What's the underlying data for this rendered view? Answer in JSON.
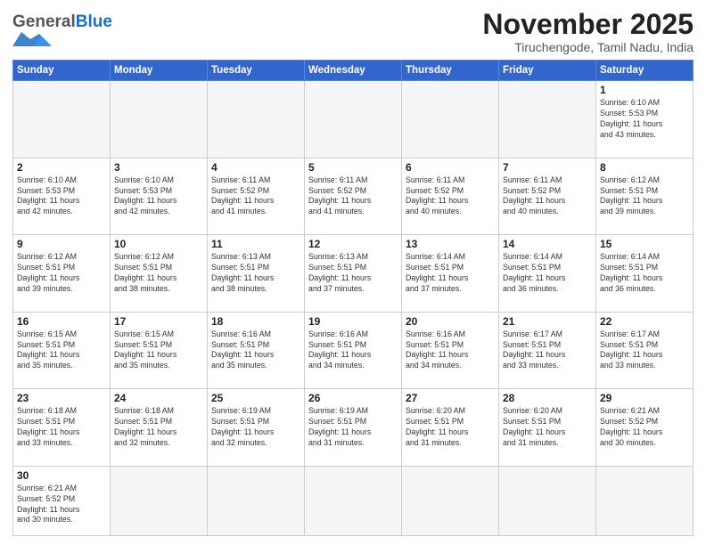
{
  "header": {
    "logo_general": "General",
    "logo_blue": "Blue",
    "month_title": "November 2025",
    "location": "Tiruchengode, Tamil Nadu, India"
  },
  "days_of_week": [
    "Sunday",
    "Monday",
    "Tuesday",
    "Wednesday",
    "Thursday",
    "Friday",
    "Saturday"
  ],
  "weeks": [
    [
      {
        "day": "",
        "info": ""
      },
      {
        "day": "",
        "info": ""
      },
      {
        "day": "",
        "info": ""
      },
      {
        "day": "",
        "info": ""
      },
      {
        "day": "",
        "info": ""
      },
      {
        "day": "",
        "info": ""
      },
      {
        "day": "1",
        "info": "Sunrise: 6:10 AM\nSunset: 5:53 PM\nDaylight: 11 hours\nand 43 minutes."
      }
    ],
    [
      {
        "day": "2",
        "info": "Sunrise: 6:10 AM\nSunset: 5:53 PM\nDaylight: 11 hours\nand 42 minutes."
      },
      {
        "day": "3",
        "info": "Sunrise: 6:10 AM\nSunset: 5:53 PM\nDaylight: 11 hours\nand 42 minutes."
      },
      {
        "day": "4",
        "info": "Sunrise: 6:11 AM\nSunset: 5:52 PM\nDaylight: 11 hours\nand 41 minutes."
      },
      {
        "day": "5",
        "info": "Sunrise: 6:11 AM\nSunset: 5:52 PM\nDaylight: 11 hours\nand 41 minutes."
      },
      {
        "day": "6",
        "info": "Sunrise: 6:11 AM\nSunset: 5:52 PM\nDaylight: 11 hours\nand 40 minutes."
      },
      {
        "day": "7",
        "info": "Sunrise: 6:11 AM\nSunset: 5:52 PM\nDaylight: 11 hours\nand 40 minutes."
      },
      {
        "day": "8",
        "info": "Sunrise: 6:12 AM\nSunset: 5:51 PM\nDaylight: 11 hours\nand 39 minutes."
      }
    ],
    [
      {
        "day": "9",
        "info": "Sunrise: 6:12 AM\nSunset: 5:51 PM\nDaylight: 11 hours\nand 39 minutes."
      },
      {
        "day": "10",
        "info": "Sunrise: 6:12 AM\nSunset: 5:51 PM\nDaylight: 11 hours\nand 38 minutes."
      },
      {
        "day": "11",
        "info": "Sunrise: 6:13 AM\nSunset: 5:51 PM\nDaylight: 11 hours\nand 38 minutes."
      },
      {
        "day": "12",
        "info": "Sunrise: 6:13 AM\nSunset: 5:51 PM\nDaylight: 11 hours\nand 37 minutes."
      },
      {
        "day": "13",
        "info": "Sunrise: 6:14 AM\nSunset: 5:51 PM\nDaylight: 11 hours\nand 37 minutes."
      },
      {
        "day": "14",
        "info": "Sunrise: 6:14 AM\nSunset: 5:51 PM\nDaylight: 11 hours\nand 36 minutes."
      },
      {
        "day": "15",
        "info": "Sunrise: 6:14 AM\nSunset: 5:51 PM\nDaylight: 11 hours\nand 36 minutes."
      }
    ],
    [
      {
        "day": "16",
        "info": "Sunrise: 6:15 AM\nSunset: 5:51 PM\nDaylight: 11 hours\nand 35 minutes."
      },
      {
        "day": "17",
        "info": "Sunrise: 6:15 AM\nSunset: 5:51 PM\nDaylight: 11 hours\nand 35 minutes."
      },
      {
        "day": "18",
        "info": "Sunrise: 6:16 AM\nSunset: 5:51 PM\nDaylight: 11 hours\nand 35 minutes."
      },
      {
        "day": "19",
        "info": "Sunrise: 6:16 AM\nSunset: 5:51 PM\nDaylight: 11 hours\nand 34 minutes."
      },
      {
        "day": "20",
        "info": "Sunrise: 6:16 AM\nSunset: 5:51 PM\nDaylight: 11 hours\nand 34 minutes."
      },
      {
        "day": "21",
        "info": "Sunrise: 6:17 AM\nSunset: 5:51 PM\nDaylight: 11 hours\nand 33 minutes."
      },
      {
        "day": "22",
        "info": "Sunrise: 6:17 AM\nSunset: 5:51 PM\nDaylight: 11 hours\nand 33 minutes."
      }
    ],
    [
      {
        "day": "23",
        "info": "Sunrise: 6:18 AM\nSunset: 5:51 PM\nDaylight: 11 hours\nand 33 minutes."
      },
      {
        "day": "24",
        "info": "Sunrise: 6:18 AM\nSunset: 5:51 PM\nDaylight: 11 hours\nand 32 minutes."
      },
      {
        "day": "25",
        "info": "Sunrise: 6:19 AM\nSunset: 5:51 PM\nDaylight: 11 hours\nand 32 minutes."
      },
      {
        "day": "26",
        "info": "Sunrise: 6:19 AM\nSunset: 5:51 PM\nDaylight: 11 hours\nand 31 minutes."
      },
      {
        "day": "27",
        "info": "Sunrise: 6:20 AM\nSunset: 5:51 PM\nDaylight: 11 hours\nand 31 minutes."
      },
      {
        "day": "28",
        "info": "Sunrise: 6:20 AM\nSunset: 5:51 PM\nDaylight: 11 hours\nand 31 minutes."
      },
      {
        "day": "29",
        "info": "Sunrise: 6:21 AM\nSunset: 5:52 PM\nDaylight: 11 hours\nand 30 minutes."
      }
    ],
    [
      {
        "day": "30",
        "info": "Sunrise: 6:21 AM\nSunset: 5:52 PM\nDaylight: 11 hours\nand 30 minutes."
      },
      {
        "day": "",
        "info": ""
      },
      {
        "day": "",
        "info": ""
      },
      {
        "day": "",
        "info": ""
      },
      {
        "day": "",
        "info": ""
      },
      {
        "day": "",
        "info": ""
      },
      {
        "day": "",
        "info": ""
      }
    ]
  ]
}
